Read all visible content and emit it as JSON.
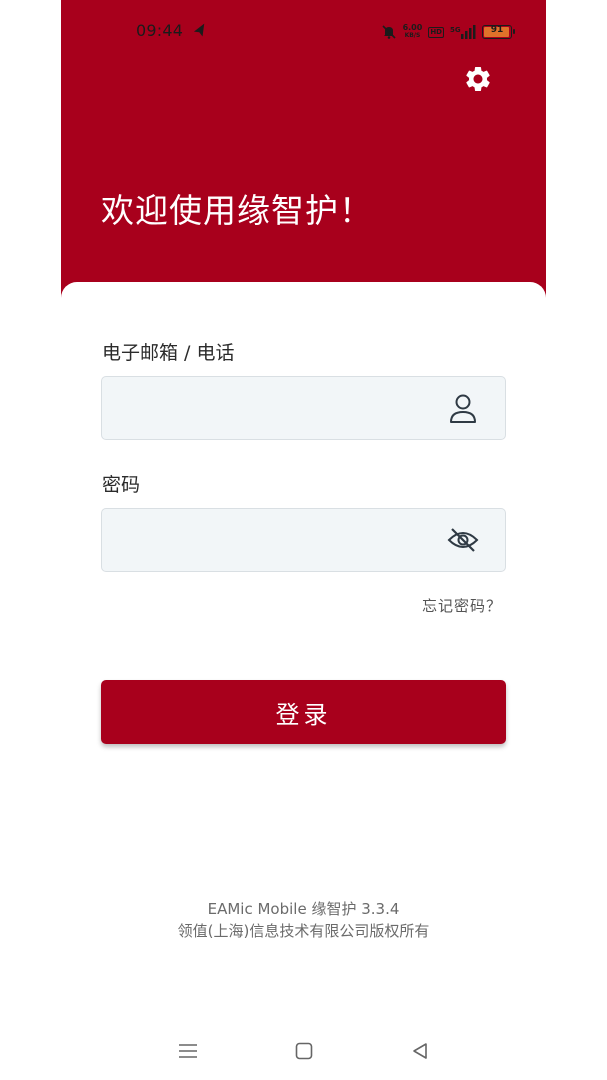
{
  "status_bar": {
    "time": "09:44",
    "net_speed_value": "6.00",
    "net_speed_unit": "KB/S",
    "hd_label": "HD",
    "signal_label": "5G",
    "battery_level": "91"
  },
  "header": {
    "welcome_text": "欢迎使用缘智护！"
  },
  "form": {
    "email_label": "电子邮箱 / 电话",
    "email_value": "",
    "password_label": "密码",
    "password_value": "",
    "forgot_password": "忘记密码？",
    "login_button": "登录"
  },
  "footer": {
    "version": "EAMic Mobile 缘智护 3.3.4",
    "copyright": "领值(上海)信息技术有限公司版权所有"
  },
  "colors": {
    "brand": "#a8001c",
    "input_bg": "#f2f6f8",
    "battery": "#e0712a"
  },
  "icons": {
    "settings": "gear-icon",
    "email_field": "user-icon",
    "password_field": "eye-off-icon",
    "nav_menu": "menu-icon",
    "nav_home": "square-icon",
    "nav_back": "triangle-back-icon"
  }
}
